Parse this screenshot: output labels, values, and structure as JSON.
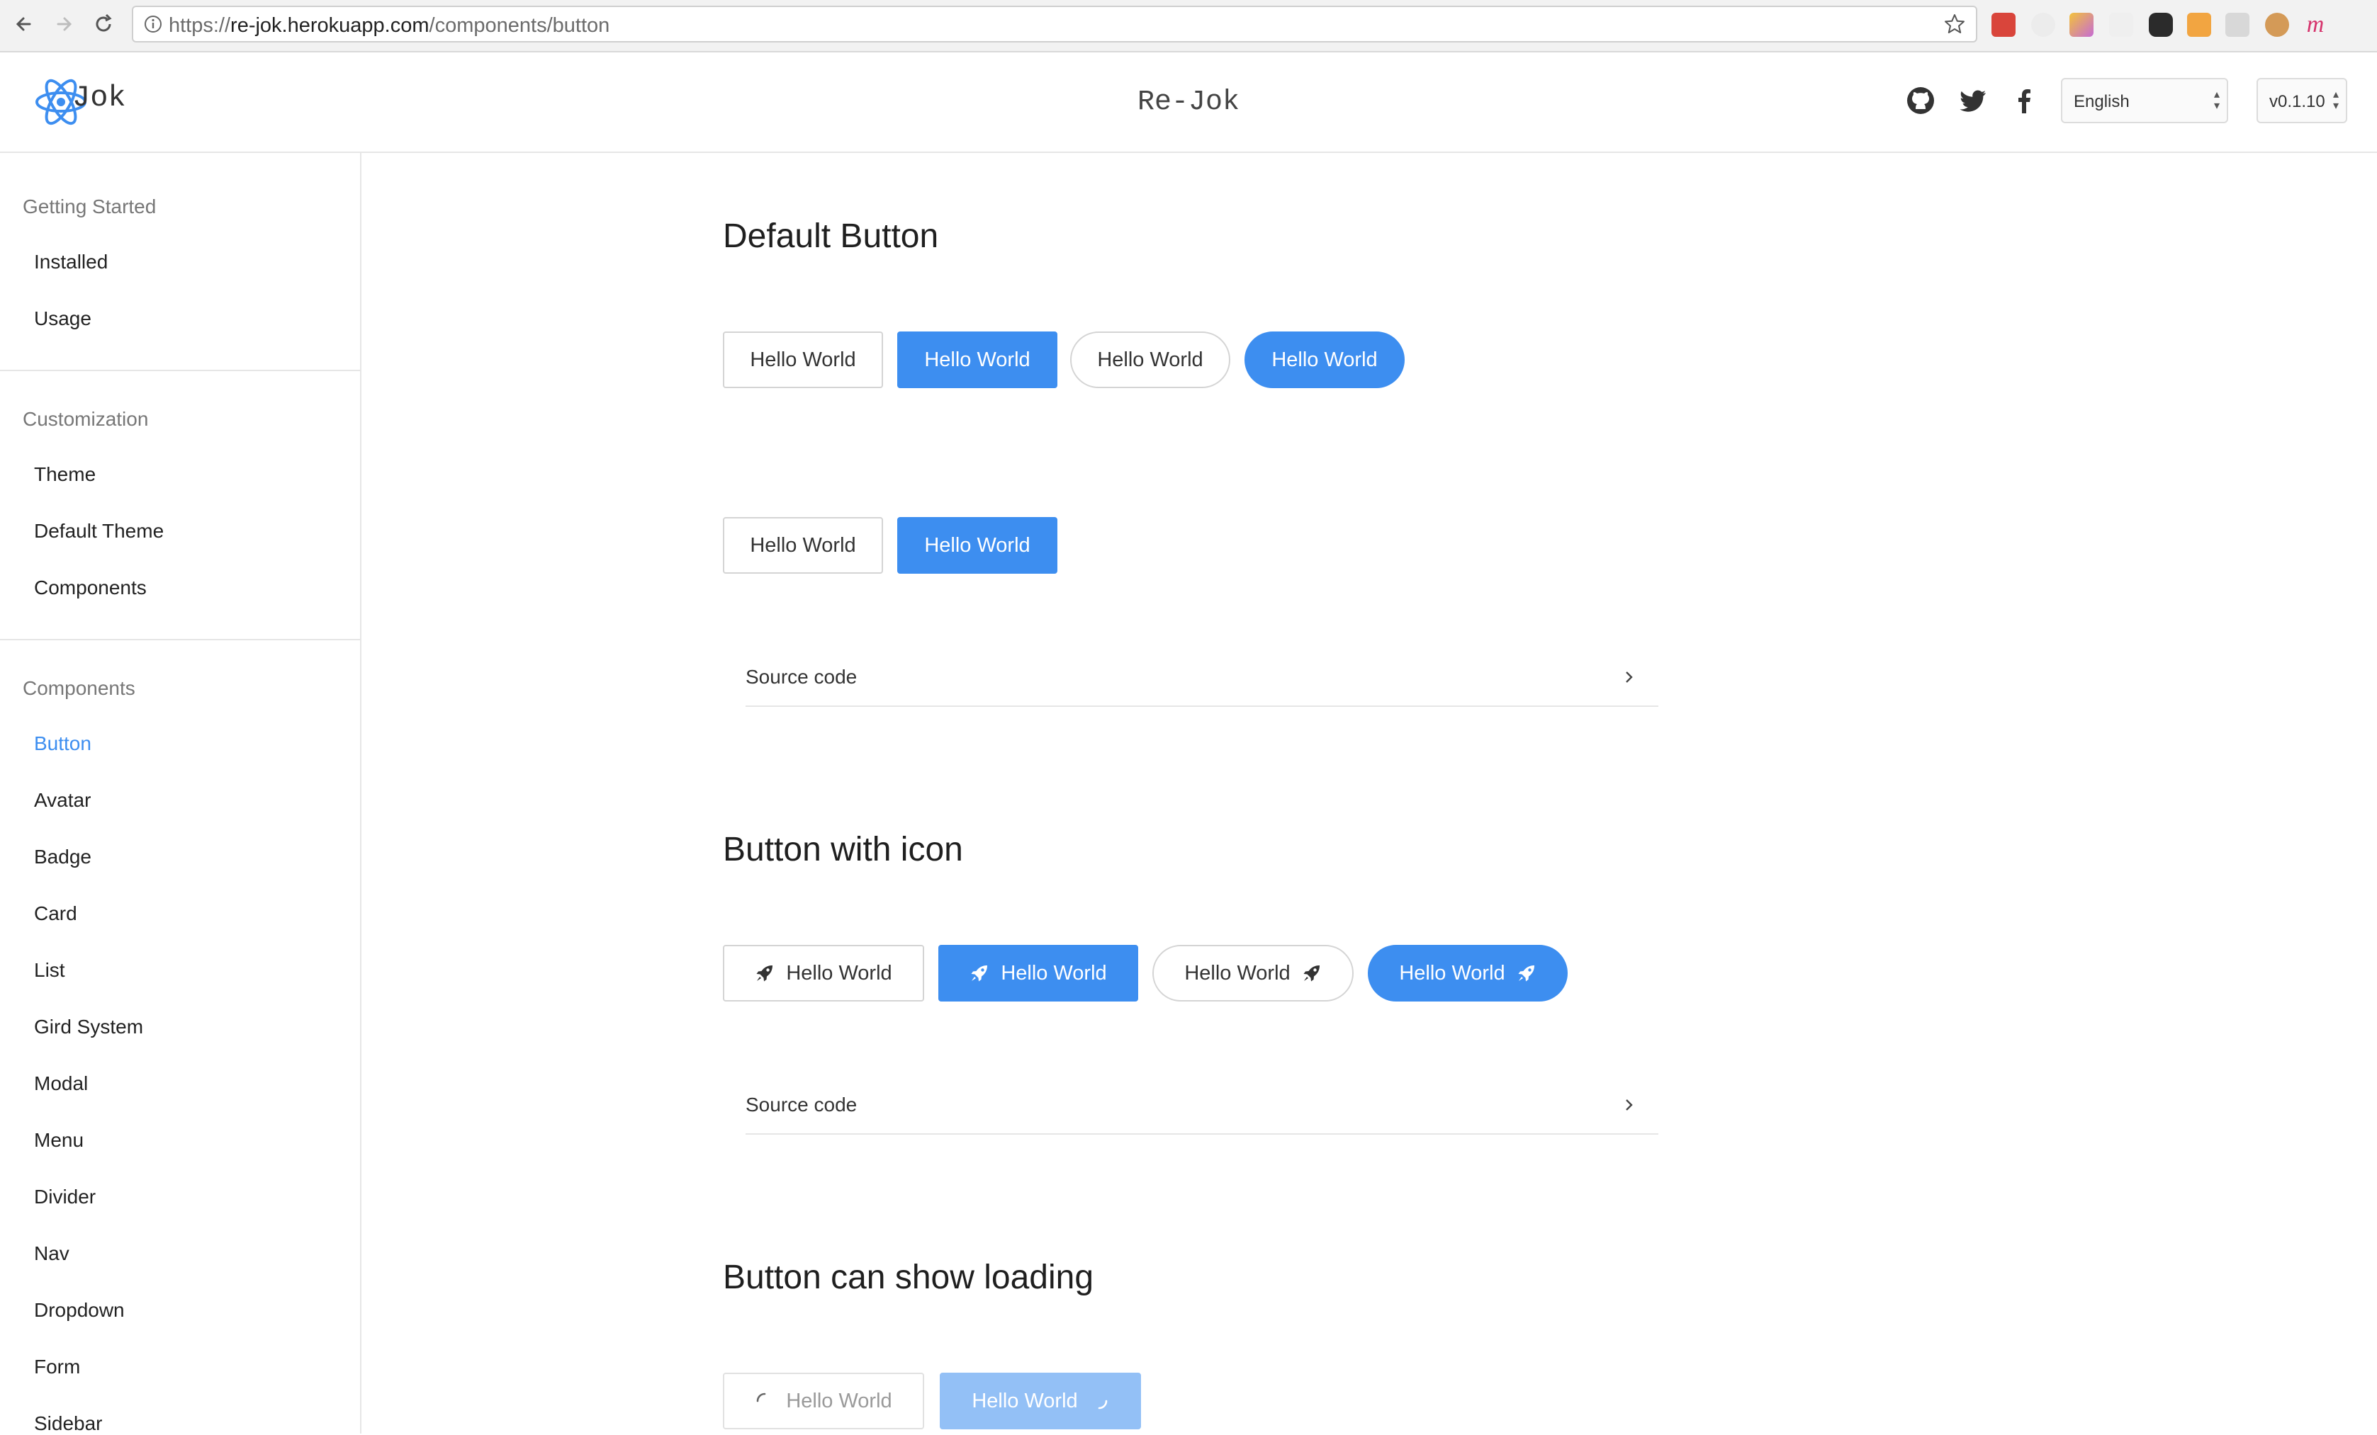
{
  "browser": {
    "url_host": "re-jok.herokuapp.com",
    "url_scheme": "https://",
    "url_path": "/components/button"
  },
  "header": {
    "logo_text": "Jok",
    "title": "Re-Jok",
    "icons": [
      "github-icon",
      "twitter-icon",
      "facebook-icon"
    ],
    "language": "English",
    "version": "v0.1.10"
  },
  "sidebar": {
    "sections": [
      {
        "title": "Getting Started",
        "items": [
          "Installed",
          "Usage"
        ]
      },
      {
        "title": "Customization",
        "items": [
          "Theme",
          "Default Theme",
          "Components"
        ]
      },
      {
        "title": "Components",
        "items": [
          "Button",
          "Avatar",
          "Badge",
          "Card",
          "List",
          "Gird System",
          "Modal",
          "Menu",
          "Divider",
          "Nav",
          "Dropdown",
          "Form",
          "Sidebar"
        ]
      }
    ],
    "active_item": "Button"
  },
  "main": {
    "default_button": {
      "title": "Default Button",
      "labels": [
        "Hello World",
        "Hello World",
        "Hello World",
        "Hello World",
        "Hello World",
        "Hello World"
      ],
      "source_label": "Source code"
    },
    "icon_button": {
      "title": "Button with icon",
      "labels": [
        "Hello World",
        "Hello World",
        "Hello World",
        "Hello World"
      ],
      "icon": "rocket-icon",
      "source_label": "Source code"
    },
    "loading_button": {
      "title": "Button can show loading",
      "labels": [
        "Hello World",
        "Hello World"
      ],
      "icon": "spinner-icon"
    }
  },
  "colors": {
    "accent": "#3d8ef0",
    "accent_disabled": "#93c0f6"
  }
}
